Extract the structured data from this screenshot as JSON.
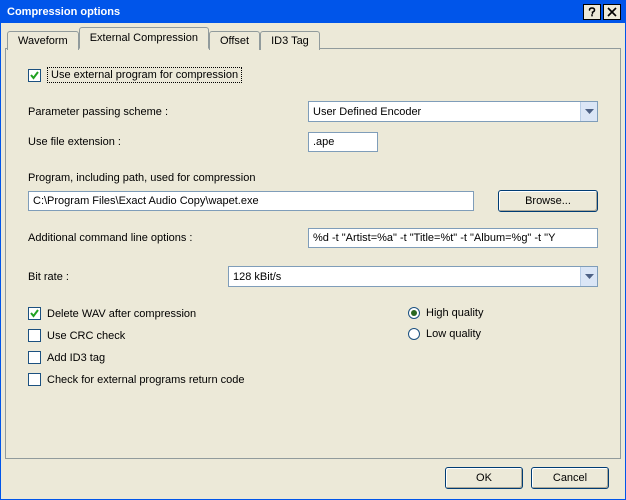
{
  "window": {
    "title": "Compression options",
    "help_icon": "help-icon",
    "close_icon": "close-icon"
  },
  "tabs": {
    "waveform": "Waveform",
    "external": "External Compression",
    "offset": "Offset",
    "id3": "ID3 Tag"
  },
  "main": {
    "use_external_label": "Use external program for compression",
    "use_external_checked": true,
    "param_scheme_label": "Parameter passing scheme :",
    "param_scheme_value": "User Defined Encoder",
    "use_ext_label": "Use file extension :",
    "use_ext_value": ".ape",
    "program_label": "Program, including path, used for compression",
    "program_value": "C:\\Program Files\\Exact Audio Copy\\wapet.exe",
    "browse_label": "Browse...",
    "cmd_label": "Additional command line options :",
    "cmd_value": "%d -t \"Artist=%a\" -t \"Title=%t\" -t \"Album=%g\" -t \"Y",
    "bitrate_label": "Bit rate :",
    "bitrate_value": "128 kBit/s",
    "delete_wav_label": "Delete WAV after compression",
    "delete_wav_checked": true,
    "crc_label": "Use CRC check",
    "crc_checked": false,
    "add_id3_label": "Add ID3 tag",
    "add_id3_checked": false,
    "return_code_label": "Check for external programs return code",
    "return_code_checked": false,
    "high_quality_label": "High quality",
    "high_quality_selected": true,
    "low_quality_label": "Low quality",
    "low_quality_selected": false
  },
  "buttons": {
    "ok": "OK",
    "cancel": "Cancel"
  }
}
